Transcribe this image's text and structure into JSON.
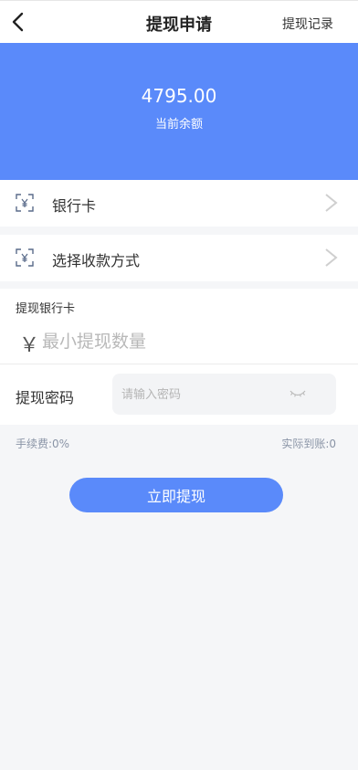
{
  "header": {
    "title": "提现申请",
    "history_link": "提现记录"
  },
  "balance": {
    "amount": "4795.00",
    "label": "当前余额"
  },
  "rows": [
    {
      "label": "银行卡",
      "icon": "scan-yen-icon"
    },
    {
      "label": "选择收款方式",
      "icon": "scan-yen-icon"
    }
  ],
  "form": {
    "section_label": "提现银行卡",
    "currency_symbol": "￥",
    "amount_placeholder": "最小提现数量",
    "password_label": "提现密码",
    "password_placeholder": "请输入密码"
  },
  "fees": {
    "fee": "手续费:0%",
    "actual": "实际到账:0"
  },
  "submit_label": "立即提现",
  "colors": {
    "accent": "#5a8afa",
    "background": "#f5f6f8",
    "muted_text": "#8a94a6"
  }
}
